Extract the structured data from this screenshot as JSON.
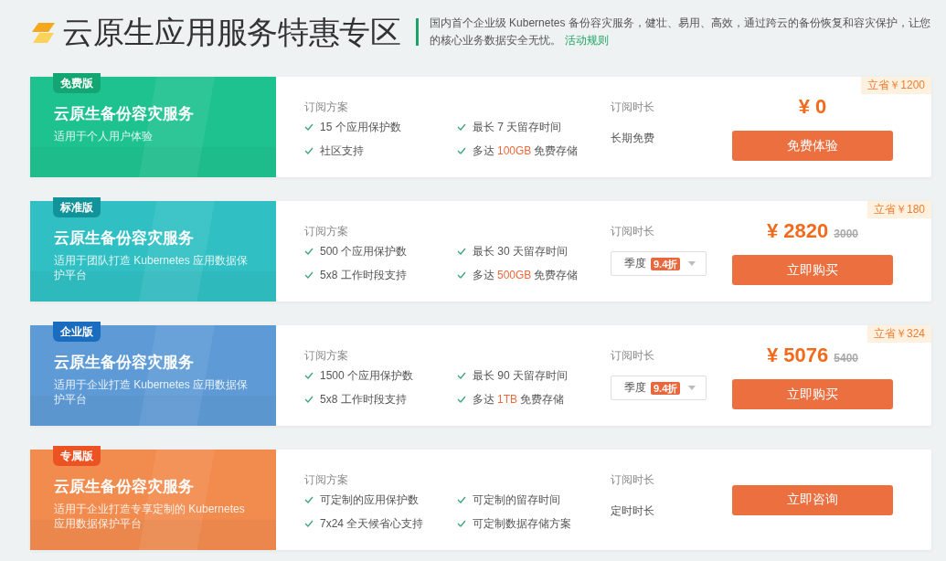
{
  "header": {
    "title": "云原生应用服务特惠专区",
    "description": "国内首个企业级 Kubernetes 备份容灾服务，健壮、易用、高效，通过跨云的备份恢复和容灾保护，让您的核心业务数据安全无忧。",
    "link": "活动规则"
  },
  "plans": [
    {
      "badge": {
        "text": "免费版",
        "color": "#13a572"
      },
      "color": "#1ec28e",
      "title": "云原生备份容灾服务",
      "subtitle": "适用于个人用户体验",
      "plan_label": "订阅方案",
      "features": [
        {
          "text": "15 个应用保护数"
        },
        {
          "text": "最长 7 天留存时间"
        },
        {
          "text": "社区支持"
        },
        {
          "text": "多达",
          "highlight": "100GB",
          "after": "免费存储"
        }
      ],
      "duration_label": "订阅时长",
      "duration": {
        "kind": "text",
        "text": "长期免费"
      },
      "price": "¥ 0",
      "button": "免费体验",
      "savings": "立省￥1200"
    },
    {
      "badge": {
        "text": "标准版",
        "color": "#12939a"
      },
      "color": "#30bfc3",
      "title": "云原生备份容灾服务",
      "subtitle": "适用于团队打造 Kubernetes 应用数据保护平台",
      "plan_label": "订阅方案",
      "features": [
        {
          "text": "500 个应用保护数"
        },
        {
          "text": "最长 30 天留存时间"
        },
        {
          "text": "5x8 工作时段支持"
        },
        {
          "text": "多达",
          "highlight": "500GB",
          "after": "免费存储"
        }
      ],
      "duration_label": "订阅时长",
      "duration": {
        "kind": "select",
        "value": "季度",
        "discount": "9.4折"
      },
      "price": "¥ 2820",
      "original_price": "3000",
      "button": "立即购买",
      "savings": "立省￥180"
    },
    {
      "badge": {
        "text": "企业版",
        "color": "#1a6cbf"
      },
      "color": "#5e9bd6",
      "title": "云原生备份容灾服务",
      "subtitle": "适用于企业打造 Kubernetes 应用数据保护平台",
      "plan_label": "订阅方案",
      "features": [
        {
          "text": "1500 个应用保护数"
        },
        {
          "text": "最长 90 天留存时间"
        },
        {
          "text": "5x8 工作时段支持"
        },
        {
          "text": "多达",
          "highlight": "1TB",
          "after": "免费存储"
        }
      ],
      "duration_label": "订阅时长",
      "duration": {
        "kind": "select",
        "value": "季度",
        "discount": "9.4折"
      },
      "price": "¥ 5076",
      "original_price": "5400",
      "button": "立即购买",
      "savings": "立省￥324"
    },
    {
      "badge": {
        "text": "专属版",
        "color": "#ec5322"
      },
      "color": "#f28b4e",
      "title": "云原生备份容灾服务",
      "subtitle": "适用于企业打造专享定制的 Kubernetes 应用数据保护平台",
      "plan_label": "订阅方案",
      "features": [
        {
          "text": "可定制的应用保护数"
        },
        {
          "text": "可定制的留存时间"
        },
        {
          "text": "7x24 全天候省心支持"
        },
        {
          "text": "可定制数据存储方案"
        }
      ],
      "duration_label": "订阅时长",
      "duration": {
        "kind": "text",
        "text": "定时时长"
      },
      "button": "立即咨询"
    }
  ]
}
